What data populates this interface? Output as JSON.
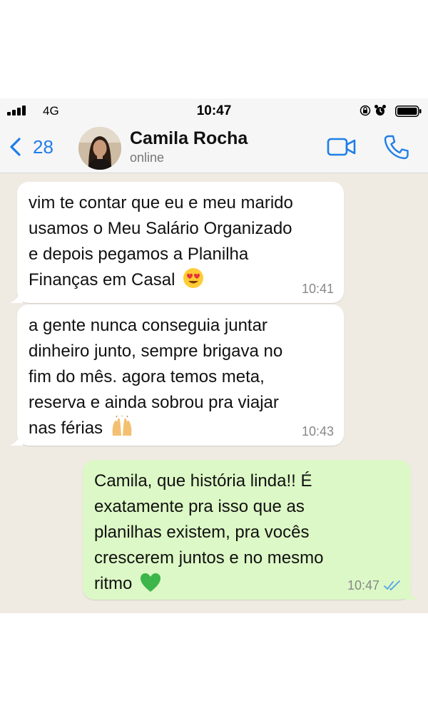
{
  "status_bar": {
    "network": "4G",
    "time": "10:47",
    "icons": [
      "signal-icon",
      "lock-rotation-icon",
      "alarm-icon",
      "battery-icon"
    ]
  },
  "header": {
    "back_count": "28",
    "contact_name": "Camila Rocha",
    "contact_status": "online",
    "icons": [
      "back-chevron-icon",
      "video-call-icon",
      "phone-call-icon"
    ],
    "accent_color": "#1f7ee8"
  },
  "messages": [
    {
      "direction": "incoming",
      "text": "vim te contar que eu e meu marido\nusamos o Meu Salário Organizado\ne depois pegamos a Planilha\nFinanças em Casal",
      "emoji": "heart-eyes-emoji",
      "time": "10:41"
    },
    {
      "direction": "incoming",
      "text": "a gente nunca conseguia juntar\ndinheiro junto, sempre brigava no\nfim do mês. agora temos meta,\nreserva e ainda sobrou pra viajar\nnas férias",
      "emoji": "raising-hands-emoji",
      "time": "10:43"
    },
    {
      "direction": "outgoing",
      "text": "Camila, que história linda!! É\nexatamente pra isso que as\nplanilhas existem, pra vocês\ncrescerem juntos e no mesmo\nritmo",
      "emoji": "green-heart-emoji",
      "time": "10:47",
      "read_receipt": "double-check-icon"
    }
  ],
  "colors": {
    "chat_background": "#efeae2",
    "incoming_bubble": "#ffffff",
    "outgoing_bubble": "#dcf8c6",
    "read_check": "#4fa3e8"
  }
}
